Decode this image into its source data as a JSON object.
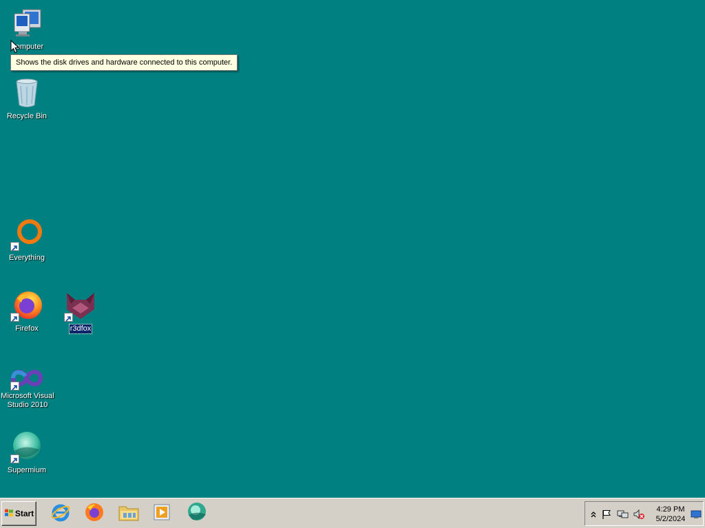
{
  "desktop": {
    "background_color": "#008080",
    "icons": [
      {
        "label": "Computer",
        "icon": "computer-icon"
      },
      {
        "label": "Recycle Bin",
        "icon": "recycle-bin-icon"
      },
      {
        "label": "Everything",
        "icon": "everything-icon",
        "shortcut": true
      },
      {
        "label": "Firefox",
        "icon": "firefox-icon",
        "shortcut": true
      },
      {
        "label": "r3dfox",
        "icon": "r3dfox-icon",
        "shortcut": true,
        "selected": true
      },
      {
        "label": "Microsoft Visual Studio 2010",
        "icon": "visual-studio-icon",
        "shortcut": true
      },
      {
        "label": "Supermium",
        "icon": "supermium-icon",
        "shortcut": true
      }
    ]
  },
  "tooltip": {
    "text": "Shows the disk drives and hardware connected to this computer."
  },
  "taskbar": {
    "start_label": "Start",
    "pinned": [
      {
        "icon": "internet-explorer-icon"
      },
      {
        "icon": "firefox-icon"
      },
      {
        "icon": "file-explorer-icon"
      },
      {
        "icon": "media-player-icon"
      },
      {
        "icon": "supermium-icon"
      }
    ],
    "tray": {
      "icons": [
        "show-hidden-icons-chevron",
        "action-center-flag-icon",
        "network-icon",
        "volume-muted-icon"
      ],
      "time": "4:29 PM",
      "date": "5/2/2024"
    }
  }
}
